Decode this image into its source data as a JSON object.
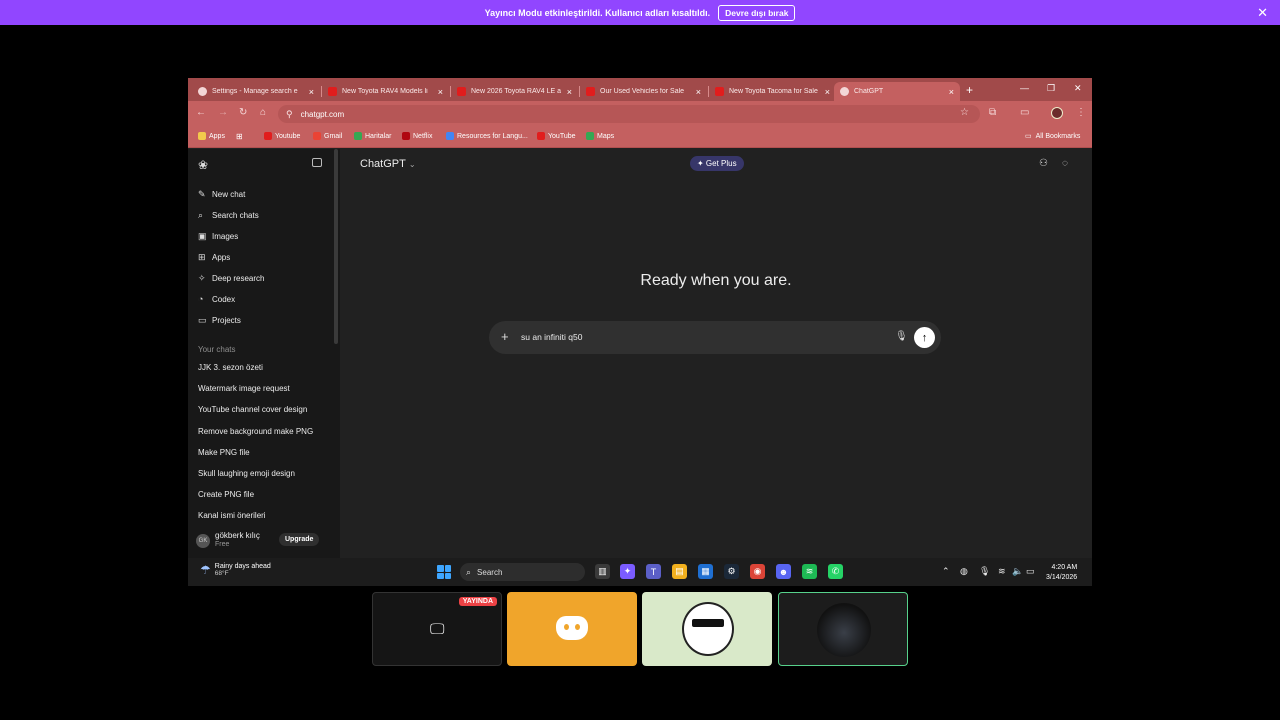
{
  "banner": {
    "message": "Yayıncı Modu etkinleştirildi. Kullanıcı adları kısaltıldı.",
    "button_label": "Devre dışı bırak",
    "close_icon": "✕"
  },
  "browser": {
    "tabs": [
      {
        "title": "Settings - Manage search e",
        "favicon_color": "#f3d6d6"
      },
      {
        "title": "New Toyota RAV4 Models li",
        "favicon_color": "#e11d1d"
      },
      {
        "title": "New 2026 Toyota RAV4 LE a",
        "favicon_color": "#e11d1d"
      },
      {
        "title": "Our Used Vehicles for Sale",
        "favicon_color": "#e11d1d"
      },
      {
        "title": "New Toyota Tacoma for Sale",
        "favicon_color": "#e11d1d"
      },
      {
        "title": "ChatGPT",
        "favicon_color": "#f3d6d6"
      }
    ],
    "url": "chatgpt.com",
    "bookmarks": [
      {
        "label": "Apps",
        "color": "#f2c94c"
      },
      {
        "label": "Youtube",
        "color": "#e11d1d"
      },
      {
        "label": "Gmail",
        "color": "#ea4335"
      },
      {
        "label": "Haritalar",
        "color": "#34a853"
      },
      {
        "label": "Netflix",
        "color": "#b00610"
      },
      {
        "label": "Resources for Langu...",
        "color": "#4285f4"
      },
      {
        "label": "YouTube",
        "color": "#e11d1d"
      },
      {
        "label": "Maps",
        "color": "#34a853"
      }
    ],
    "all_bookmarks": "All Bookmarks"
  },
  "sidebar": {
    "nav": [
      {
        "label": "New chat",
        "icon": "✎"
      },
      {
        "label": "Search chats",
        "icon": "⌕"
      },
      {
        "label": "Images",
        "icon": "▣"
      },
      {
        "label": "Apps",
        "icon": "⊞"
      },
      {
        "label": "Deep research",
        "icon": "✧"
      },
      {
        "label": "Codex",
        "icon": "◔"
      },
      {
        "label": "Projects",
        "icon": "▭"
      }
    ],
    "section_title": "Your chats",
    "chats": [
      "JJK 3. sezon özeti",
      "Watermark image request",
      "YouTube channel cover design",
      "Remove background make PNG",
      "Make PNG file",
      "Skull laughing emoji design",
      "Create PNG file",
      "Kanal ismi önerileri"
    ],
    "user": {
      "initials": "GK",
      "name": "gökberk kılıç",
      "plan": "Free",
      "upgrade_label": "Upgrade"
    }
  },
  "main": {
    "model_label": "ChatGPT",
    "get_plus_label": "✦ Get Plus",
    "hero": "Ready when you are.",
    "composer_text": "su an infiniti q50"
  },
  "taskbar": {
    "weather_title": "Rainy days ahead",
    "weather_temp": "68°F",
    "search_label": "Search",
    "apps": [
      {
        "name": "task-view-icon",
        "color": "#3a3a3a",
        "glyph": "▥"
      },
      {
        "name": "copilot-icon",
        "color": "#7b5cff",
        "glyph": "✦"
      },
      {
        "name": "teams-icon",
        "color": "#5b5fc7",
        "glyph": "T"
      },
      {
        "name": "file-explorer-icon",
        "color": "#f2b01e",
        "glyph": "▤"
      },
      {
        "name": "store-icon",
        "color": "#1f6fd1",
        "glyph": "▦"
      },
      {
        "name": "steam-icon",
        "color": "#1b2838",
        "glyph": "⚙"
      },
      {
        "name": "chrome-icon",
        "color": "#db4437",
        "glyph": "◉"
      },
      {
        "name": "discord-icon",
        "color": "#5865f2",
        "glyph": "☻"
      },
      {
        "name": "spotify-icon",
        "color": "#1db954",
        "glyph": "≋"
      },
      {
        "name": "whatsapp-icon",
        "color": "#25d366",
        "glyph": "✆"
      }
    ],
    "time": "4:20 AM",
    "date": "3/14/2026"
  },
  "call": {
    "live_label": "YAYINDA"
  }
}
